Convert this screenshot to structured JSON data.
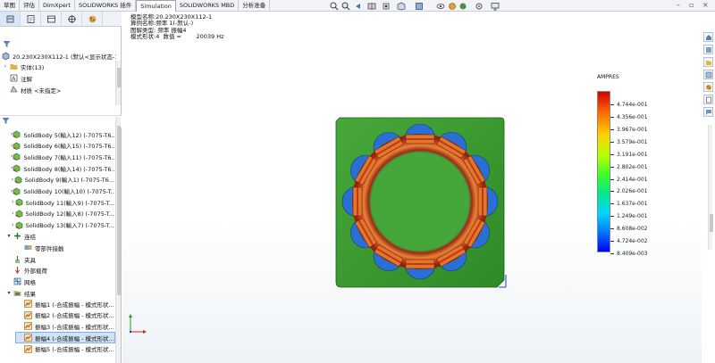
{
  "tabs": [
    {
      "label": "草图",
      "active": false
    },
    {
      "label": "评估",
      "active": false
    },
    {
      "label": "DimXpert",
      "active": false
    },
    {
      "label": "SOLIDWORKS 插件",
      "active": false
    },
    {
      "label": "Simulation",
      "active": true
    },
    {
      "label": "SOLIDWORKS MBD",
      "active": false
    },
    {
      "label": "分析准备",
      "active": false
    }
  ],
  "tree": {
    "root_label": "20.230X230X112-1  (默认<显示状态-1>)",
    "top_items": [
      {
        "label": "实体(13)",
        "icon": "folder-icon"
      },
      {
        "label": "注解",
        "icon": "annotation-icon"
      },
      {
        "label": "材质 <未指定>",
        "icon": "material-icon"
      }
    ],
    "solid_bodies": [
      "SolidBody 5(輸入12) (-7075-T6...",
      "SolidBody 6(輸入15) (-7075-T6...",
      "SolidBody 7(輸入11) (-7075-T6...",
      "SolidBody 8(輸入14) (-7075-T6...",
      "SolidBody 9(輸入1) (-7075-T6...",
      "SolidBody 10(輸入10) (-7075-T...",
      "SolidBody 11(輸入9) (-7075-T...",
      "SolidBody 12(輸入8) (-7075-T...",
      "SolidBody 13(輸入7) (-7075-T..."
    ],
    "study_items": [
      {
        "label": "连结",
        "icon": "connection-icon",
        "expanded": true
      },
      {
        "label": "零部件接触",
        "icon": "contact-icon",
        "indent": true
      },
      {
        "label": "夹具",
        "icon": "fixture-icon"
      },
      {
        "label": "外部载荷",
        "icon": "load-icon"
      },
      {
        "label": "网格",
        "icon": "mesh-icon"
      },
      {
        "label": "结果",
        "icon": "results-folder-icon",
        "expanded": true
      }
    ],
    "results": [
      {
        "label": "振幅1 (-合成振幅 - 模式形状...",
        "selected": false
      },
      {
        "label": "振幅2 (-合成振幅 - 模式形状...",
        "selected": false
      },
      {
        "label": "振幅3 (-合成振幅 - 模式形状...",
        "selected": false
      },
      {
        "label": "振幅4 (-合成振幅 - 模式形状...",
        "selected": true
      },
      {
        "label": "振幅5 (-合成振幅 - 模式形状...",
        "selected": false
      }
    ]
  },
  "plot_info": {
    "model": "模型名称:20.230X230X112-1",
    "study": "算例名称:频率 1(-默认-)",
    "plot_type": "图解类型: 频率 振幅4",
    "mode": "模式形状:4  数值 =        20039 Hz"
  },
  "legend": {
    "title": "AMPRES",
    "labels": [
      "4.744e-001",
      "4.356e-001",
      "3.967e-001",
      "3.579e-001",
      "3.191e-001",
      "2.802e-001",
      "2.414e-001",
      "2.026e-001",
      "1.637e-001",
      "1.249e-001",
      "8.608e-002",
      "4.724e-002",
      "8.409e-003"
    ]
  },
  "colors": {
    "plate": "#3e9a2c",
    "ring_red": "#c2361e",
    "ring_orange": "#e0782a",
    "hole_blue": "#2a6fd4",
    "tab_active_border": "#9aa6b5"
  }
}
